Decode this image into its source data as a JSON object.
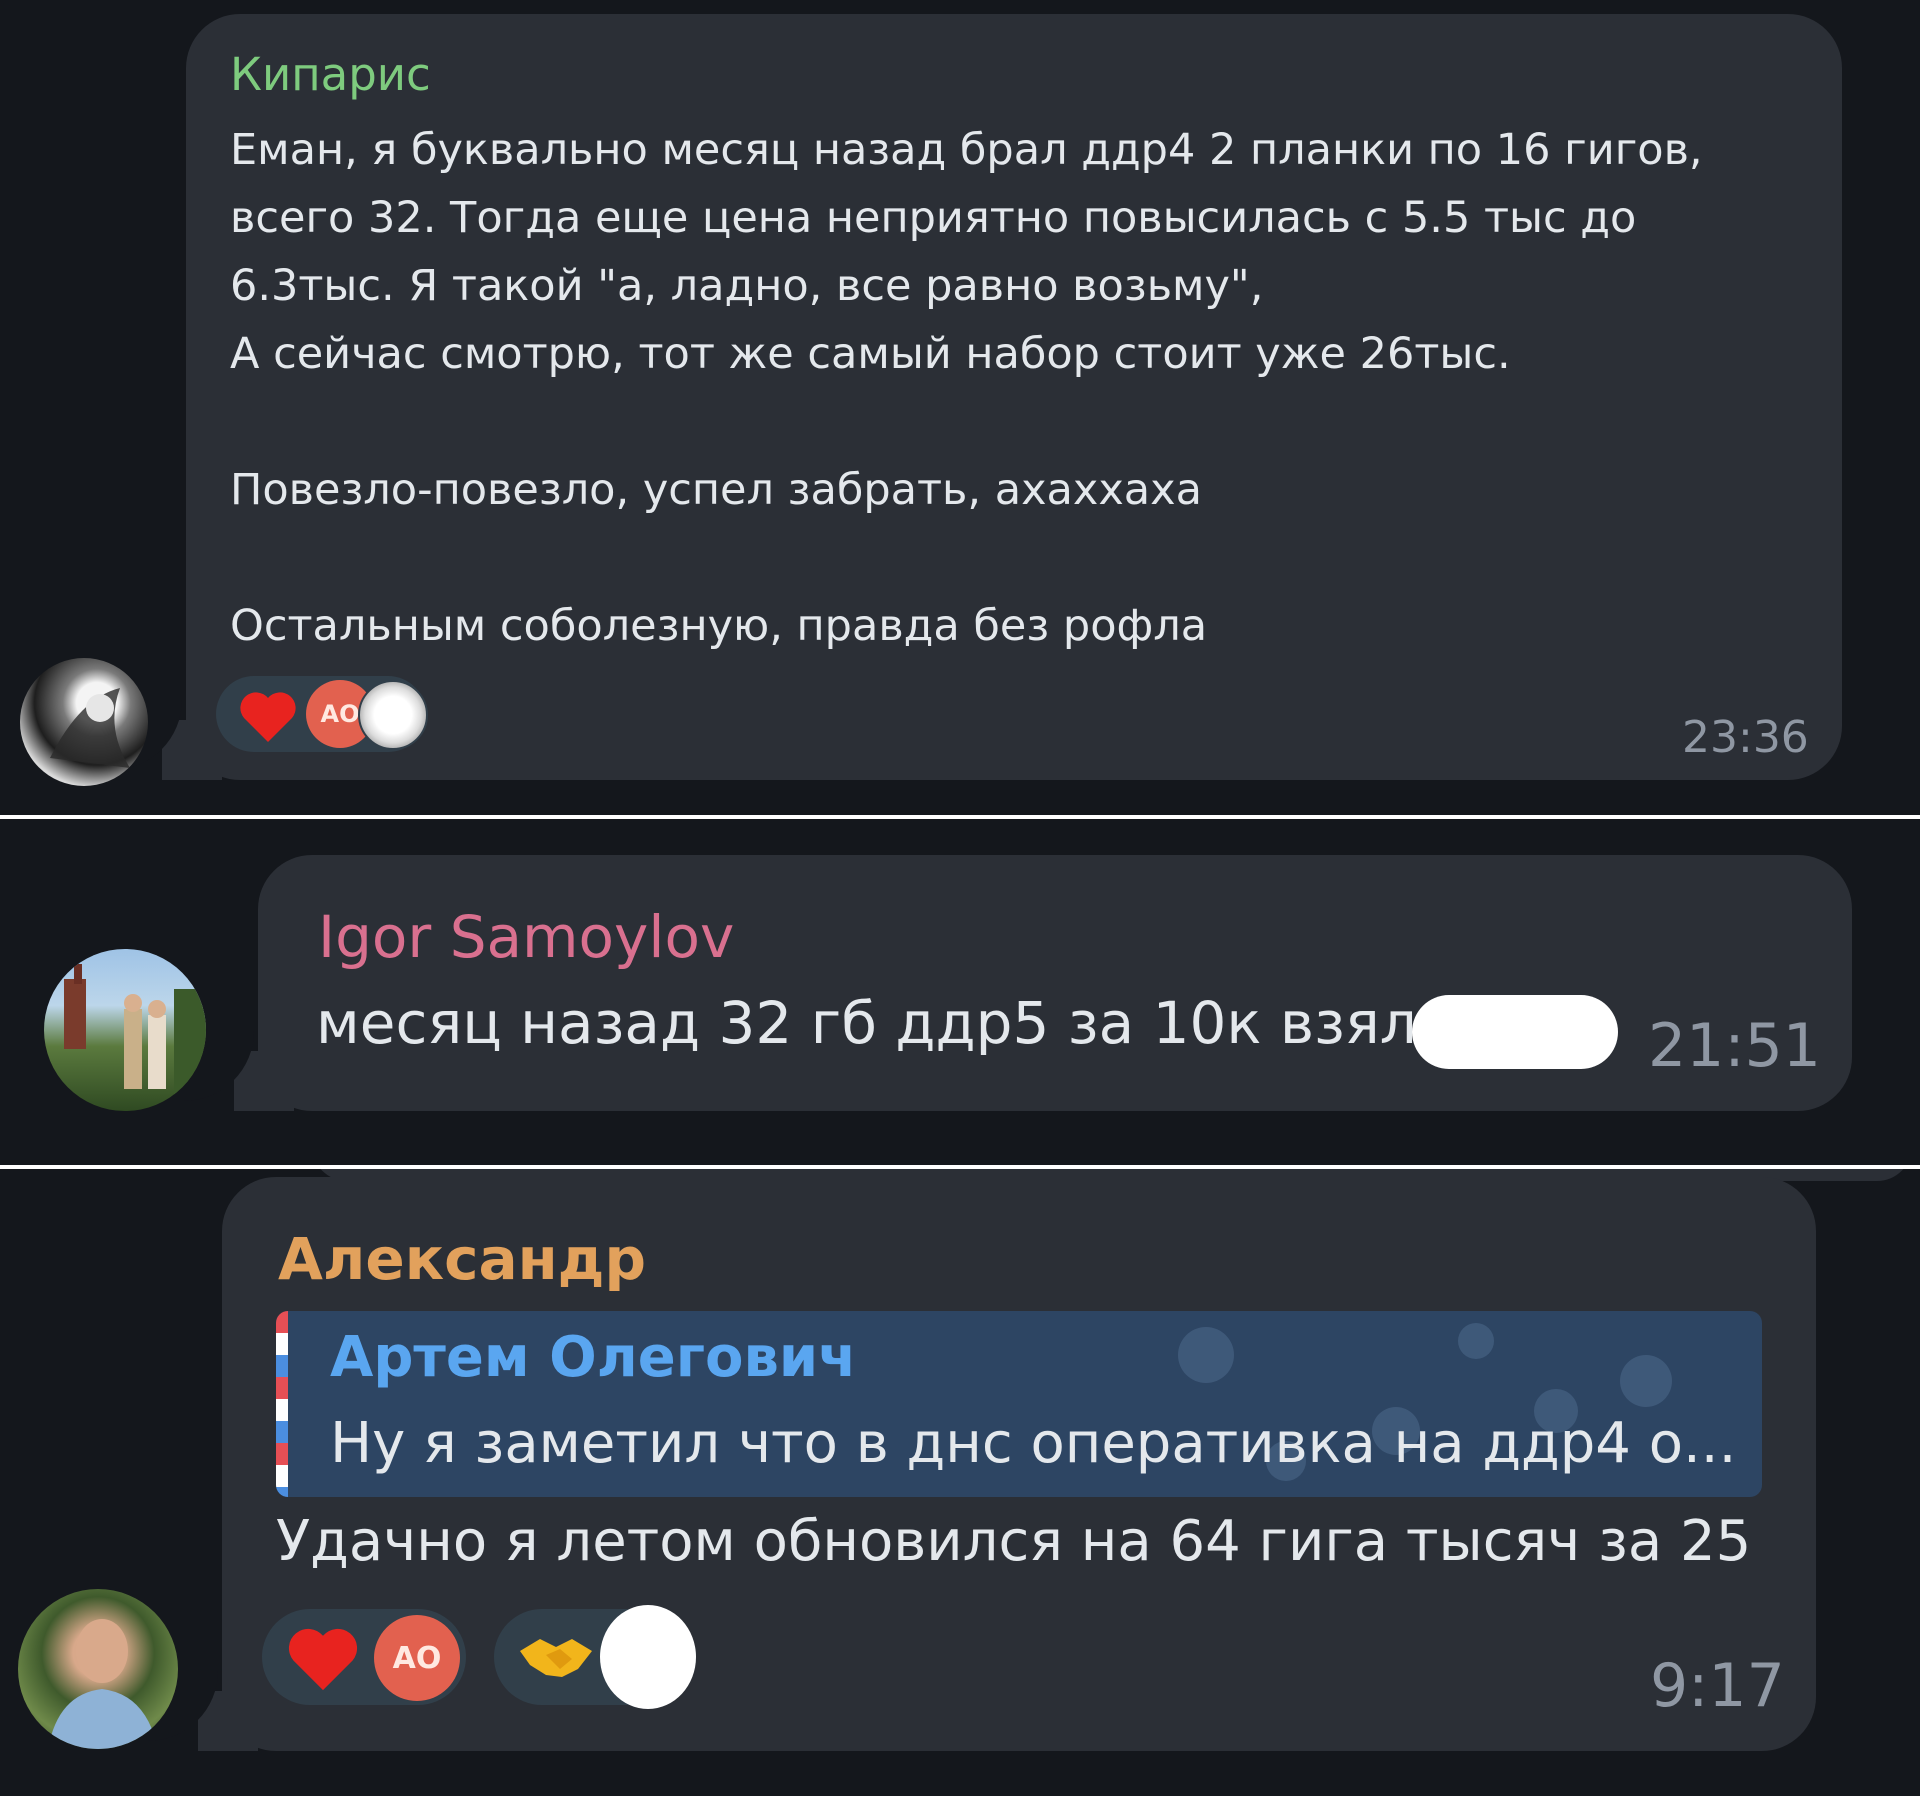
{
  "colors": {
    "background": "#14171c",
    "bubble": "#2b2f36",
    "text": "#e9edf1",
    "timestamp": "#8f97a3",
    "reaction_pill": "#313f4a",
    "reactor_badge": "#e2614f"
  },
  "messages": [
    {
      "sender": "Кипарис",
      "sender_color": "#7ecb7e",
      "lines": [
        "Еман, я буквально месяц назад брал ддр4 2 планки по 16 гигов,",
        "всего 32. Тогда еще цена неприятно повысилась с 5.5 тыс до",
        "6.3тыс. Я такой \"а, ладно, все равно возьму\",",
        "А сейчас смотрю, тот же самый набор стоит уже 26тыс.",
        "",
        "Повезло-повезло, успел забрать, ахаххаха",
        "",
        "Остальным соболезную, правда без рофла"
      ],
      "reactions": {
        "emoji": "heart",
        "reactor_initials": "АО",
        "extra": "sticker-avatar"
      },
      "time": "23:36"
    },
    {
      "sender": "Igor Samoylov",
      "sender_color": "#d9708f",
      "text": "месяц назад 32 гб ддр5 за 10к взял",
      "time": "21:51"
    },
    {
      "sender": "Александр",
      "sender_color": "#e2a15c",
      "reply": {
        "author": "Артем Олегович",
        "author_color": "#5aa6f0",
        "text": "Ну я заметил что в днс оперативка на ддр4 о..."
      },
      "text": "Удачно я летом обновился на 64 гига тысяч за 25",
      "reactions": [
        {
          "emoji": "heart",
          "reactor_initials": "АО"
        },
        {
          "emoji": "handshake",
          "reactor": "hidden"
        }
      ],
      "time": "9:17"
    }
  ]
}
